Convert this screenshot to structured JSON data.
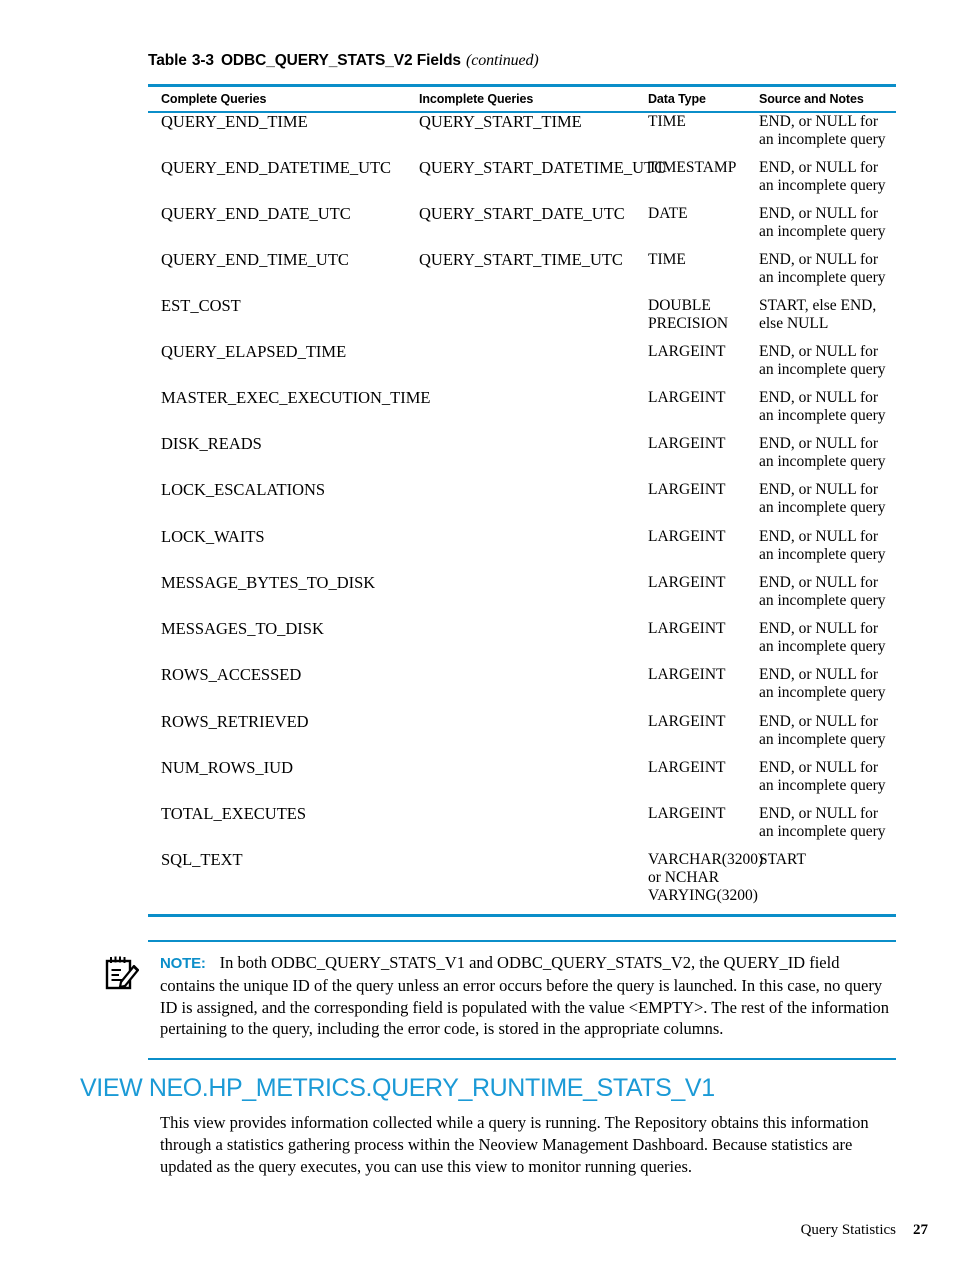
{
  "table": {
    "caption_label": "Table",
    "caption_number": "3-3",
    "caption_title": "ODBC_QUERY_STATS_V2 Fields",
    "caption_continued": "(continued)",
    "accent_color": "#0b8ec9",
    "columns": [
      "Complete Queries",
      "Incomplete Queries",
      "Data Type",
      "Source and Notes"
    ],
    "rows": [
      {
        "complete": "QUERY_END_TIME",
        "incomplete": "QUERY_START_TIME",
        "datatype": "TIME",
        "source": "END, or NULL for\nan incomplete query"
      },
      {
        "complete": "QUERY_END_DATETIME_UTC",
        "incomplete": "QUERY_START_DATETIME_UTC",
        "datatype": "TIMESTAMP",
        "source": "END, or NULL for\nan incomplete query"
      },
      {
        "complete": "QUERY_END_DATE_UTC",
        "incomplete": "QUERY_START_DATE_UTC",
        "datatype": "DATE",
        "source": "END, or NULL for\nan incomplete query"
      },
      {
        "complete": "QUERY_END_TIME_UTC",
        "incomplete": "QUERY_START_TIME_UTC",
        "datatype": "TIME",
        "source": "END, or NULL for\nan incomplete query"
      },
      {
        "complete": "EST_COST",
        "incomplete": "",
        "datatype": "DOUBLE\nPRECISION",
        "source": "START, else END,\nelse NULL"
      },
      {
        "complete": "QUERY_ELAPSED_TIME",
        "incomplete": "",
        "datatype": "LARGEINT",
        "source": "END, or NULL for\nan incomplete query"
      },
      {
        "complete": "MASTER_EXEC_EXECUTION_TIME",
        "incomplete": "",
        "datatype": "LARGEINT",
        "source": "END, or NULL for\nan incomplete query"
      },
      {
        "complete": "DISK_READS",
        "incomplete": "",
        "datatype": "LARGEINT",
        "source": "END, or NULL for\nan incomplete query"
      },
      {
        "complete": "LOCK_ESCALATIONS",
        "incomplete": "",
        "datatype": "LARGEINT",
        "source": "END, or NULL for\nan incomplete query"
      },
      {
        "complete": "LOCK_WAITS",
        "incomplete": "",
        "datatype": "LARGEINT",
        "source": "END, or NULL for\nan incomplete query"
      },
      {
        "complete": "MESSAGE_BYTES_TO_DISK",
        "incomplete": "",
        "datatype": "LARGEINT",
        "source": "END, or NULL for\nan incomplete query"
      },
      {
        "complete": "MESSAGES_TO_DISK",
        "incomplete": "",
        "datatype": "LARGEINT",
        "source": "END, or NULL for\nan incomplete query"
      },
      {
        "complete": "ROWS_ACCESSED",
        "incomplete": "",
        "datatype": "LARGEINT",
        "source": "END, or NULL for\nan incomplete query"
      },
      {
        "complete": "ROWS_RETRIEVED",
        "incomplete": "",
        "datatype": "LARGEINT",
        "source": "END, or NULL for\nan incomplete query"
      },
      {
        "complete": "NUM_ROWS_IUD",
        "incomplete": "",
        "datatype": "LARGEINT",
        "source": "END, or NULL for\nan incomplete query"
      },
      {
        "complete": "TOTAL_EXECUTES",
        "incomplete": "",
        "datatype": "LARGEINT",
        "source": "END, or NULL for\nan incomplete query"
      },
      {
        "complete": "SQL_TEXT",
        "incomplete": "",
        "datatype": "VARCHAR(3200)\nor NCHAR\nVARYING(3200)",
        "source": "START"
      }
    ]
  },
  "note": {
    "icon": "note-pencil-icon",
    "label": "NOTE:",
    "text": "In both ODBC_QUERY_STATS_V1 and ODBC_QUERY_STATS_V2, the QUERY_ID field contains the unique ID of the query unless an error occurs before the query is launched. In this case, no query ID is assigned, and the corresponding field is populated with the value <EMPTY>. The rest of the information pertaining to the query, including the error code, is stored in the appropriate columns."
  },
  "section": {
    "heading": "VIEW NEO.HP_METRICS.QUERY_RUNTIME_STATS_V1",
    "heading_color": "#1b9ad6",
    "body": "This view provides information collected while a query is running. The Repository obtains this information through a statistics gathering process within the Neoview Management Dashboard. Because statistics are updated as the query executes, you can use this view to monitor running queries."
  },
  "footer": {
    "title": "Query Statistics",
    "page_number": "27"
  }
}
